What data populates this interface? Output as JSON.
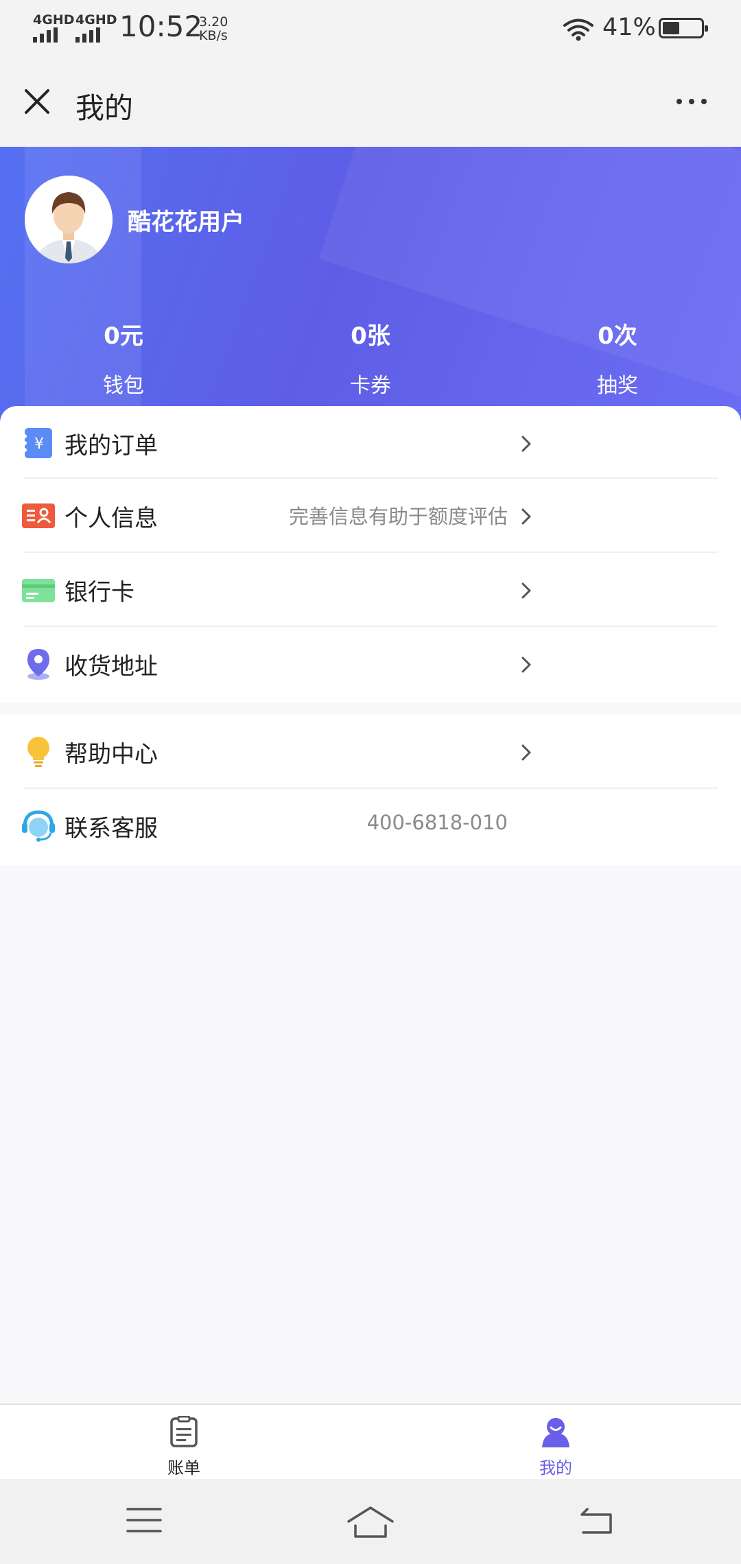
{
  "status_bar": {
    "signal1_label": "4GHD",
    "signal2_label": "4GHD",
    "time": "10:52",
    "speed_value": "3.20",
    "speed_unit": "KB/s",
    "battery_percent": "41%"
  },
  "header": {
    "title": "我的",
    "close_icon": "close-icon",
    "more_icon": "more-icon"
  },
  "profile": {
    "username": "酷花花用户",
    "stats": [
      {
        "value": "0元",
        "label": "钱包"
      },
      {
        "value": "0张",
        "label": "卡券"
      },
      {
        "value": "0次",
        "label": "抽奖"
      }
    ]
  },
  "menu": {
    "group1": [
      {
        "label": "我的订单",
        "icon": "order-icon",
        "hint": ""
      },
      {
        "label": "个人信息",
        "icon": "id-card-icon",
        "hint": "完善信息有助于额度评估"
      },
      {
        "label": "银行卡",
        "icon": "bank-card-icon",
        "hint": ""
      },
      {
        "label": "收货地址",
        "icon": "location-icon",
        "hint": ""
      }
    ],
    "group2": [
      {
        "label": "帮助中心",
        "icon": "lightbulb-icon",
        "hint": ""
      },
      {
        "label": "联系客服",
        "icon": "customer-service-icon",
        "hint": "400-6818-010"
      }
    ]
  },
  "tabbar": {
    "tabs": [
      {
        "label": "账单",
        "icon": "bill-icon"
      },
      {
        "label": "我的",
        "icon": "profile-icon"
      }
    ],
    "active_color": "#6A5FE8"
  },
  "colors": {
    "hero_gradient_start": "#5570F2",
    "hero_gradient_end": "#6A6CF3",
    "accent": "#6A5FE8"
  }
}
